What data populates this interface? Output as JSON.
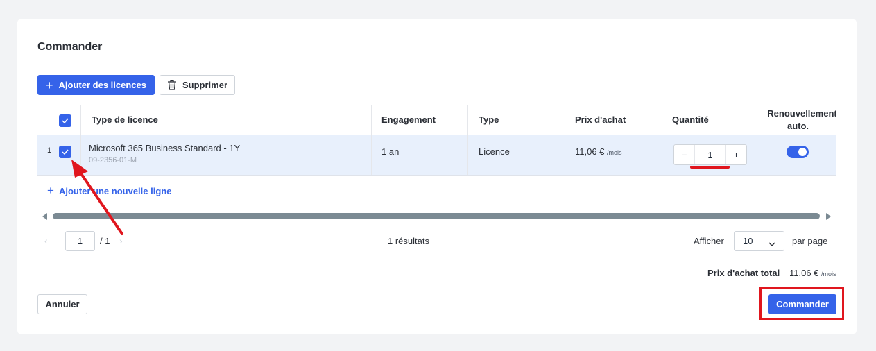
{
  "page_title": "Commander",
  "toolbar": {
    "add_label": "Ajouter des licences",
    "delete_label": "Supprimer"
  },
  "table": {
    "headers": [
      "Type de licence",
      "Engagement",
      "Type",
      "Prix d'achat",
      "Quantité",
      "Renouvellement",
      "auto."
    ],
    "row": {
      "index": "1",
      "name": "Microsoft 365 Business Standard - 1Y",
      "sku": "09-2356-01-M",
      "engagement": "1 an",
      "type": "Licence",
      "price": "11,06 €",
      "price_unit": "/mois",
      "quantity": "1",
      "auto_renew": true
    },
    "add_line_label": "Ajouter une nouvelle ligne"
  },
  "pagination": {
    "current_page": "1",
    "total_pages": "/ 1",
    "results": "1 résultats",
    "show_label": "Afficher",
    "page_size": "10",
    "per_page_label": "par page"
  },
  "total": {
    "label": "Prix d'achat total",
    "value": "11,06 €",
    "unit": "/mois"
  },
  "footer": {
    "cancel_label": "Annuler",
    "order_label": "Commander"
  },
  "colors": {
    "accent": "#3563e9",
    "row_selected": "#e8f0fc",
    "annotation": "#e0161e"
  }
}
